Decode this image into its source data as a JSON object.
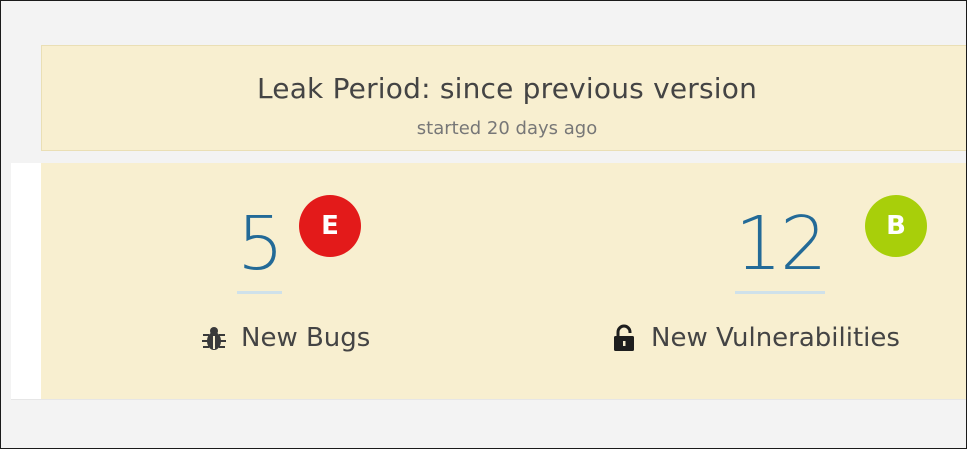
{
  "leak_period": {
    "title": "Leak Period: since previous version",
    "subtitle": "started 20 days ago"
  },
  "metrics": [
    {
      "value": "5",
      "rating": "E",
      "rating_color": "#e31a1a",
      "label": "New Bugs",
      "icon": "bug-icon",
      "value_color": "#236a97"
    },
    {
      "value": "12",
      "rating": "B",
      "rating_color": "#a8cf0a",
      "label": "New Vulnerabilities",
      "icon": "unlocked-padlock-icon",
      "value_color": "#236a97"
    }
  ]
}
